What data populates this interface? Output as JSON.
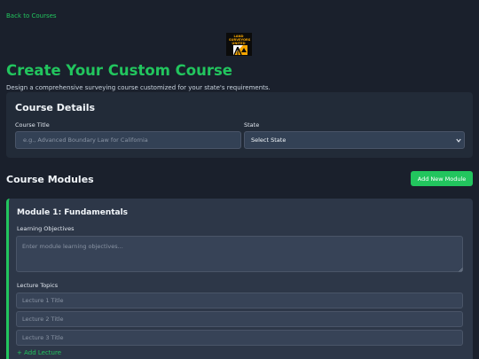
{
  "nav": {
    "back_label": "Back to Courses"
  },
  "logo": {
    "line1": "LAND",
    "line2": "SURVEYORS",
    "line3": "UNITED"
  },
  "header": {
    "title": "Create Your Custom Course",
    "subtitle": "Design a comprehensive surveying course customized for your state's requirements."
  },
  "details": {
    "heading": "Course Details",
    "course_title_label": "Course Title",
    "course_title_placeholder": "e.g., Advanced Boundary Law for California",
    "course_title_value": "",
    "state_label": "State",
    "state_selected": "Select State"
  },
  "modules_section": {
    "heading": "Course Modules",
    "add_button_label": "Add New Module"
  },
  "module": {
    "title": "Module 1: Fundamentals",
    "objectives_label": "Learning Objectives",
    "objectives_placeholder": "Enter module learning objectives...",
    "topics_label": "Lecture Topics",
    "lectures": [
      {
        "placeholder": "Lecture 1 Title",
        "value": ""
      },
      {
        "placeholder": "Lecture 2 Title",
        "value": ""
      },
      {
        "placeholder": "Lecture 3 Title",
        "value": ""
      }
    ],
    "add_lecture_label": "+ Add Lecture"
  },
  "colors": {
    "accent": "#22c55e",
    "background": "#1a202c",
    "card": "#222b38",
    "module_card": "#2d3748",
    "input": "#334155",
    "logo_gold": "#f5a500"
  },
  "icons": [
    "chevron-down-icon",
    "resize-grip-icon",
    "survey-tripod-logo"
  ]
}
